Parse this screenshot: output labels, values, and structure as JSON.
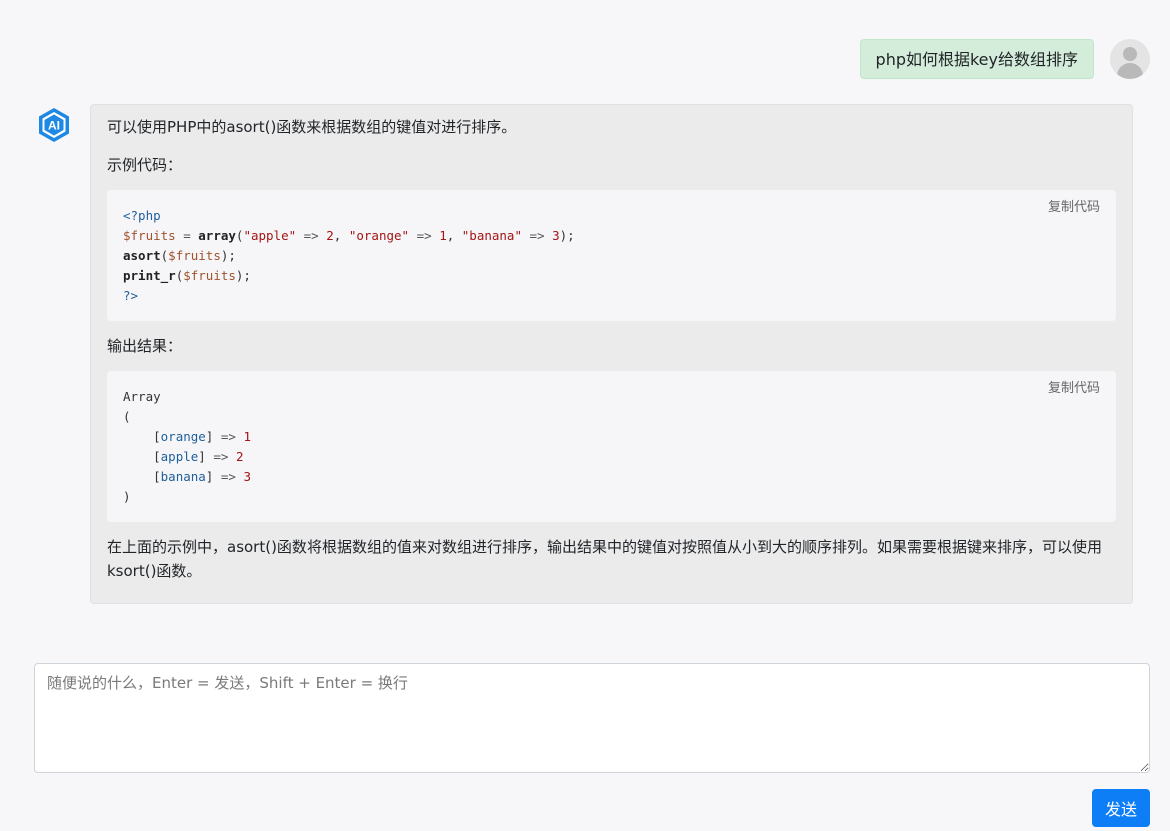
{
  "user_message": {
    "text": "php如何根据key给数组排序"
  },
  "ai_message": {
    "logo_text": "AI",
    "intro": "可以使用PHP中的asort()函数来根据数组的键值对进行排序。",
    "example_label": "示例代码：",
    "output_label": "输出结果：",
    "copy_label": "复制代码",
    "conclusion": "在上面的示例中，asort()函数将根据数组的值来对数组进行排序，输出结果中的键值对按照值从小到大的顺序排列。如果需要根据键来排序，可以使用ksort()函数。",
    "code1": {
      "open_tag": "<?php",
      "line2": {
        "var": "$fruits",
        "eq": " = ",
        "fn": "array",
        "args": [
          "\"apple\"",
          "2",
          "\"orange\"",
          "1",
          "\"banana\"",
          "3"
        ]
      },
      "line3": {
        "fn": "asort",
        "var": "$fruits"
      },
      "line4": {
        "fn": "print_r",
        "var": "$fruits"
      },
      "close_tag": "?>"
    },
    "code2": {
      "line1": "Array",
      "line2": "(",
      "rows": [
        {
          "key": "orange",
          "value": "1"
        },
        {
          "key": "apple",
          "value": "2"
        },
        {
          "key": "banana",
          "value": "3"
        }
      ],
      "line_end": ")"
    }
  },
  "input": {
    "placeholder": "随便说的什么，Enter = 发送，Shift + Enter = 换行",
    "value": ""
  },
  "send_button": {
    "label": "发送"
  },
  "colors": {
    "accent": "#0d7ef6",
    "user_bubble": "#d4edda",
    "ai_bubble": "#ebebeb",
    "logo": "#1e88e5"
  }
}
